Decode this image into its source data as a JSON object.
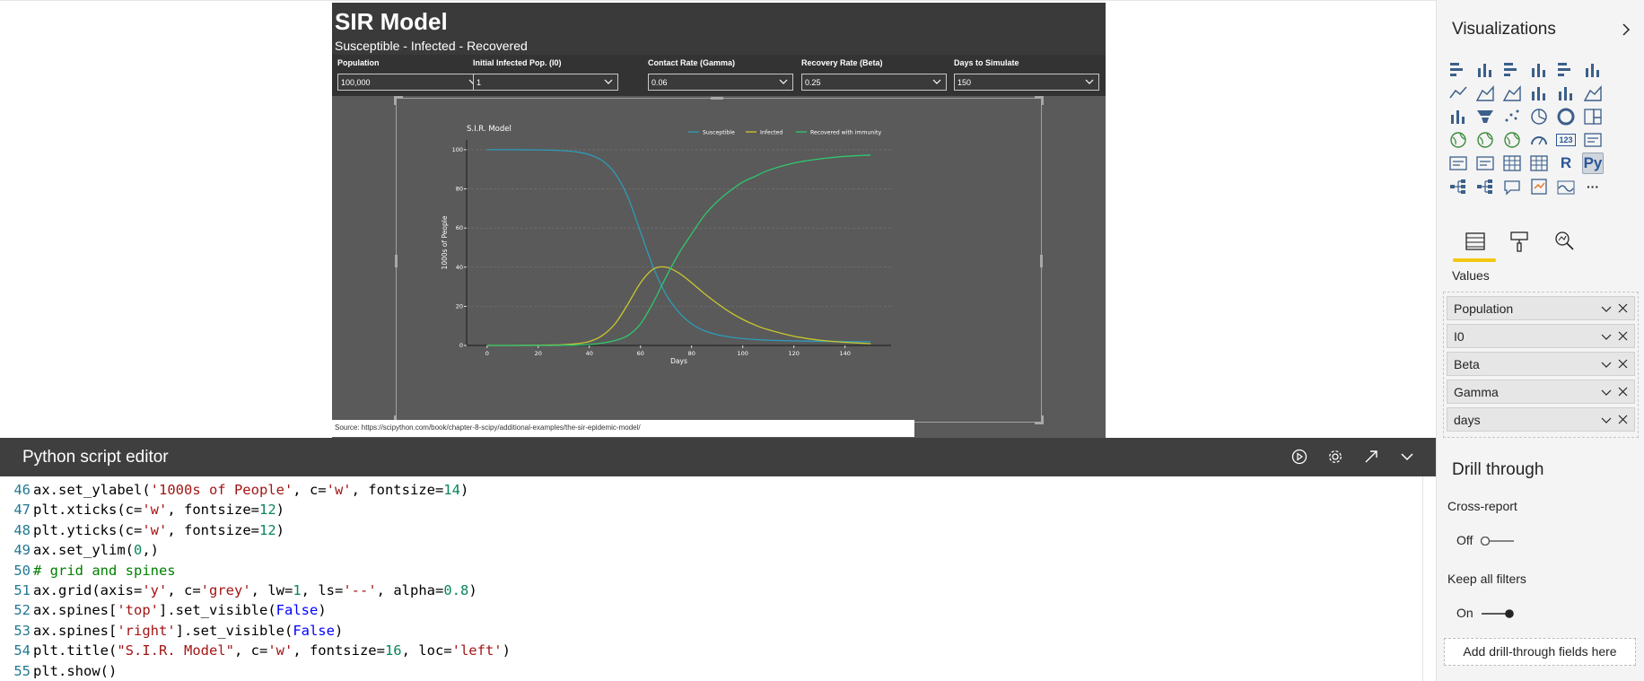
{
  "report": {
    "title": "SIR Model",
    "subtitle": "Susceptible - Infected - Recovered",
    "slicers": [
      {
        "label": "Population",
        "value": "100,000"
      },
      {
        "label": "Initial Infected Pop. (I0)",
        "value": "1"
      },
      {
        "label": "Contact Rate (Gamma)",
        "value": "0.06"
      },
      {
        "label": "Recovery Rate (Beta)",
        "value": "0.25"
      },
      {
        "label": "Days to Simulate",
        "value": "150"
      }
    ],
    "source": "Source: https://scipython.com/book/chapter-8-scipy/additional-examples/the-sir-epidemic-model/",
    "background": "#5a5a5a"
  },
  "chart_data": {
    "type": "line",
    "title": "S.I.R. Model",
    "xlabel": "Days",
    "ylabel": "1000s of People",
    "xlim": [
      -8,
      158
    ],
    "ylim": [
      0,
      105
    ],
    "xticks": [
      0,
      20,
      40,
      60,
      80,
      100,
      120,
      140
    ],
    "yticks": [
      0,
      20,
      40,
      60,
      80,
      100
    ],
    "grid": "y dashed",
    "legend_position": "top-right",
    "x": [
      0,
      10,
      20,
      25,
      30,
      35,
      40,
      45,
      50,
      55,
      60,
      65,
      70,
      75,
      80,
      85,
      90,
      95,
      100,
      105,
      110,
      120,
      130,
      140,
      150
    ],
    "series": [
      {
        "name": "Susceptible",
        "color": "#2e9bb8",
        "values": [
          100,
          100,
          99.9,
          99.8,
          99.5,
          98.9,
          97.5,
          94.5,
          88,
          76,
          58,
          40,
          26,
          17,
          11,
          7.5,
          5.5,
          4.3,
          3.5,
          3,
          2.7,
          2.3,
          2.1,
          2,
          1.9
        ]
      },
      {
        "name": "Infected",
        "color": "#c8c82e",
        "values": [
          0,
          0,
          0.1,
          0.2,
          0.4,
          0.9,
          2,
          5,
          11,
          21,
          32,
          39,
          40,
          37,
          32,
          26.5,
          21.5,
          17,
          13.3,
          10.3,
          8,
          4.7,
          2.7,
          1.6,
          0.9
        ]
      },
      {
        "name": "Recovered with immunity",
        "color": "#2ec86e",
        "values": [
          0,
          0,
          0,
          0,
          0.1,
          0.2,
          0.5,
          1.2,
          2.5,
          5,
          11,
          22,
          35,
          47,
          57,
          66.5,
          73.5,
          79,
          83.5,
          86.5,
          89.5,
          93.2,
          95.3,
          96.6,
          97.3
        ]
      }
    ]
  },
  "editor": {
    "title": "Python script editor",
    "lines": [
      {
        "n": "46",
        "tokens": [
          [
            "ax.set_ylabel(",
            ""
          ],
          [
            "'1000s of People'",
            "str"
          ],
          [
            ", c=",
            ""
          ],
          [
            "'w'",
            "str"
          ],
          [
            ", fontsize=",
            ""
          ],
          [
            "14",
            "num"
          ],
          [
            ")",
            ""
          ]
        ]
      },
      {
        "n": "47",
        "tokens": [
          [
            "plt.xticks(c=",
            ""
          ],
          [
            "'w'",
            "str"
          ],
          [
            ", fontsize=",
            ""
          ],
          [
            "12",
            "num"
          ],
          [
            ")",
            ""
          ]
        ]
      },
      {
        "n": "48",
        "tokens": [
          [
            "plt.yticks(c=",
            ""
          ],
          [
            "'w'",
            "str"
          ],
          [
            ", fontsize=",
            ""
          ],
          [
            "12",
            "num"
          ],
          [
            ")",
            ""
          ]
        ]
      },
      {
        "n": "49",
        "tokens": [
          [
            "ax.set_ylim(",
            ""
          ],
          [
            "0",
            "num"
          ],
          [
            ",)",
            ""
          ]
        ]
      },
      {
        "n": "50",
        "tokens": [
          [
            "# grid and spines",
            "com"
          ]
        ]
      },
      {
        "n": "51",
        "tokens": [
          [
            "ax.grid(axis=",
            ""
          ],
          [
            "'y'",
            "str"
          ],
          [
            ", c=",
            ""
          ],
          [
            "'grey'",
            "str"
          ],
          [
            ", lw=",
            ""
          ],
          [
            "1",
            "num"
          ],
          [
            ", ls=",
            ""
          ],
          [
            "'--'",
            "str"
          ],
          [
            ", alpha=",
            ""
          ],
          [
            "0.8",
            "num"
          ],
          [
            ")",
            ""
          ]
        ]
      },
      {
        "n": "52",
        "tokens": [
          [
            "ax.spines[",
            ""
          ],
          [
            "'top'",
            "str"
          ],
          [
            "].set_visible(",
            ""
          ],
          [
            "False",
            "kw"
          ],
          [
            ")",
            ""
          ]
        ]
      },
      {
        "n": "53",
        "tokens": [
          [
            "ax.spines[",
            ""
          ],
          [
            "'right'",
            "str"
          ],
          [
            "].set_visible(",
            ""
          ],
          [
            "False",
            "kw"
          ],
          [
            ")",
            ""
          ]
        ]
      },
      {
        "n": "54",
        "tokens": [
          [
            "plt.title(",
            ""
          ],
          [
            "\"S.I.R. Model\"",
            "str"
          ],
          [
            ", c=",
            ""
          ],
          [
            "'w'",
            "str"
          ],
          [
            ", fontsize=",
            ""
          ],
          [
            "16",
            "num"
          ],
          [
            ", loc=",
            ""
          ],
          [
            "'left'",
            "str"
          ],
          [
            ")",
            ""
          ]
        ]
      },
      {
        "n": "55",
        "tokens": [
          [
            "plt.show()",
            ""
          ]
        ]
      }
    ],
    "icons": [
      "run-icon",
      "settings-icon",
      "expand-icon",
      "collapse-icon"
    ]
  },
  "pane": {
    "title": "Visualizations",
    "values_label": "Values",
    "wells": [
      "Population",
      "I0",
      "Beta",
      "Gamma",
      "days"
    ],
    "drill_title": "Drill through",
    "cross_report_label": "Cross-report",
    "cross_report_state": "Off",
    "keep_filters_label": "Keep all filters",
    "keep_filters_state": "On",
    "add_drill_label": "Add drill-through fields here",
    "r_label": "R",
    "py_label": "Py",
    "kpi_label": "123",
    "more_label": "···",
    "accent": "#f2c811"
  }
}
